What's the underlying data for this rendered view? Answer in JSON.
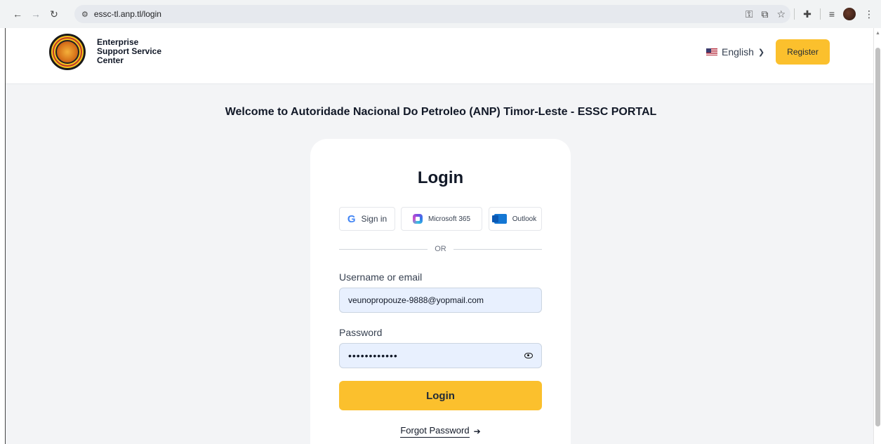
{
  "browser": {
    "url": "essc-tl.anp.tl/login"
  },
  "header": {
    "brand_lines": [
      "Enterprise",
      "Support Service",
      "Center"
    ],
    "language": "English",
    "register_label": "Register"
  },
  "main": {
    "welcome": "Welcome to Autoridade Nacional Do Petroleo (ANP) Timor-Leste - ESSC PORTAL"
  },
  "login": {
    "title": "Login",
    "sso": {
      "google_label": "Sign in",
      "microsoft_label": "Microsoft 365",
      "outlook_label": "Outlook"
    },
    "or_text": "OR",
    "username_label": "Username or email",
    "username_value": "veunopropouze-9888@yopmail.com",
    "password_label": "Password",
    "password_value": "••••••••••••",
    "submit_label": "Login",
    "forgot_label": "Forgot Password"
  },
  "colors": {
    "accent": "#fbc02d",
    "input_bg": "#e8f0fe",
    "page_bg": "#f3f4f6"
  }
}
